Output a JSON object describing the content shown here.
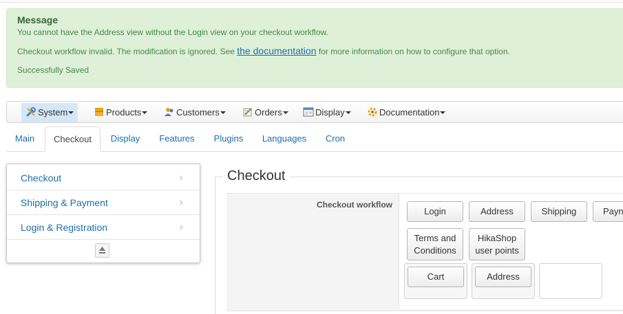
{
  "message": {
    "title": "Message",
    "line1": "You cannot have the Address view without the Login view on your checkout workflow.",
    "line2_prefix": "Checkout workflow invalid. The modification is ignored. See ",
    "line2_link": "the documentation",
    "line2_suffix": " for more information on how to configure that option.",
    "line3": "Successfully Saved"
  },
  "menu": {
    "items": [
      {
        "label": "System",
        "icon": "wrench-icon"
      },
      {
        "label": "Products",
        "icon": "products-icon"
      },
      {
        "label": "Customers",
        "icon": "customers-icon"
      },
      {
        "label": "Orders",
        "icon": "orders-icon"
      },
      {
        "label": "Display",
        "icon": "display-icon"
      },
      {
        "label": "Documentation",
        "icon": "documentation-icon"
      }
    ]
  },
  "tabs": [
    "Main",
    "Checkout",
    "Display",
    "Features",
    "Plugins",
    "Languages",
    "Cron"
  ],
  "active_tab": "Checkout",
  "sidebar": {
    "items": [
      "Checkout",
      "Shipping & Payment",
      "Login & Registration"
    ]
  },
  "checkout": {
    "title": "Checkout",
    "workflow_label": "Checkout workflow",
    "available_views": [
      "Login",
      "Address",
      "Shipping",
      "Payn",
      "Terms and\nConditions",
      "HikaShop\nuser points"
    ],
    "step_views": [
      "Cart",
      "Address"
    ]
  },
  "colors": {
    "success_bg": "#dff0d8",
    "success_text": "#468847",
    "link": "#1a6fa8",
    "menu_active_bg": "#d4e7f7"
  }
}
